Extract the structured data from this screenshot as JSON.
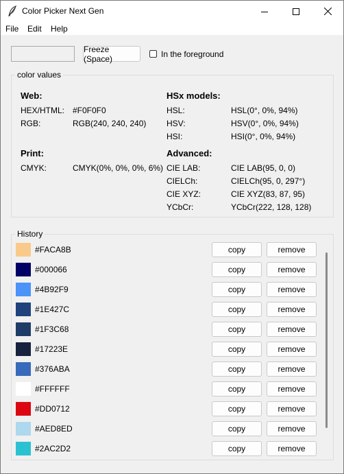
{
  "window": {
    "title": "Color Picker Next Gen"
  },
  "menu": [
    "File",
    "Edit",
    "Help"
  ],
  "toolbar": {
    "freeze_label": "Freeze (Space)",
    "foreground_label": "In the foreground",
    "current_color": "#f0f0f0"
  },
  "color_values": {
    "title": "color values",
    "web": {
      "heading": "Web:",
      "rows": [
        {
          "label": "HEX/HTML:",
          "value": "#F0F0F0"
        },
        {
          "label": "RGB:",
          "value": "RGB(240, 240, 240)"
        }
      ]
    },
    "print": {
      "heading": "Print:",
      "rows": [
        {
          "label": "CMYK:",
          "value": "CMYK(0%, 0%, 0%, 6%)"
        }
      ]
    },
    "hsx": {
      "heading": "HSx models:",
      "rows": [
        {
          "label": "HSL:",
          "value": "HSL(0°, 0%, 94%)"
        },
        {
          "label": "HSV:",
          "value": "HSV(0°, 0%, 94%)"
        },
        {
          "label": "HSI:",
          "value": "HSI(0°, 0%, 94%)"
        }
      ]
    },
    "advanced": {
      "heading": "Advanced:",
      "rows": [
        {
          "label": "CIE LAB:",
          "value": "CIE LAB(95, 0, 0)"
        },
        {
          "label": "CIELCh:",
          "value": "CIELCh(95, 0, 297°)"
        },
        {
          "label": "CIE XYZ:",
          "value": "CIE XYZ(83, 87, 95)"
        },
        {
          "label": "YCbCr:",
          "value": "YCbCr(222, 128, 128)"
        }
      ]
    }
  },
  "history": {
    "title": "History",
    "copy_label": "copy",
    "remove_label": "remove",
    "items": [
      {
        "hex": "#FACA8B",
        "color": "#FACA8B"
      },
      {
        "hex": "#000066",
        "color": "#000066"
      },
      {
        "hex": "#4B92F9",
        "color": "#4B92F9"
      },
      {
        "hex": "#1E427C",
        "color": "#1E427C"
      },
      {
        "hex": "#1F3C68",
        "color": "#1F3C68"
      },
      {
        "hex": "#17223E",
        "color": "#17223E"
      },
      {
        "hex": "#376ABA",
        "color": "#376ABA"
      },
      {
        "hex": "#FFFFFF",
        "color": "#FFFFFF"
      },
      {
        "hex": "#DD0712",
        "color": "#DD0712"
      },
      {
        "hex": "#AED8ED",
        "color": "#AED8ED"
      },
      {
        "hex": "#2AC2D2",
        "color": "#2AC2D2"
      }
    ]
  }
}
